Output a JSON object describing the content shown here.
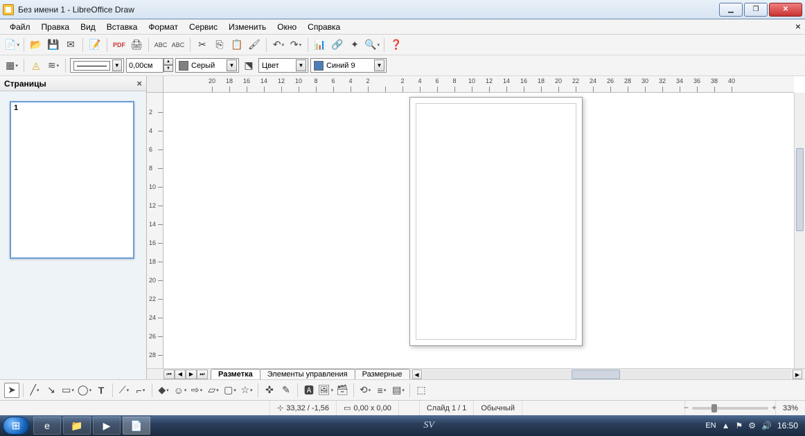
{
  "window": {
    "title": "Без имени 1 - LibreOffice Draw"
  },
  "menu": {
    "file": "Файл",
    "edit": "Правка",
    "view": "Вид",
    "insert": "Вставка",
    "format": "Формат",
    "tools": "Сервис",
    "modify": "Изменить",
    "window": "Окно",
    "help": "Справка"
  },
  "toolbar2": {
    "line_width": "0,00см",
    "area_color_label": "Серый",
    "area_color_hex": "#808080",
    "fill_mode": "Цвет",
    "line_color_label": "Синий 9",
    "line_color_hex": "#4a7ebb"
  },
  "sidebar": {
    "title": "Страницы",
    "page_number": "1"
  },
  "ruler_h": [
    "20",
    "18",
    "16",
    "14",
    "12",
    "10",
    "8",
    "6",
    "4",
    "2",
    "",
    "2",
    "4",
    "6",
    "8",
    "10",
    "12",
    "14",
    "16",
    "18",
    "20",
    "22",
    "24",
    "26",
    "28",
    "30",
    "32",
    "34",
    "36",
    "38",
    "40"
  ],
  "ruler_v": [
    "2",
    "4",
    "6",
    "8",
    "10",
    "12",
    "14",
    "16",
    "18",
    "20",
    "22",
    "24",
    "26",
    "28"
  ],
  "layer_tabs": {
    "t1": "Разметка",
    "t2": "Элементы управления",
    "t3": "Размерные"
  },
  "status": {
    "pos": "33,32 / -1,56",
    "size": "0,00 x 0,00",
    "slide": "Слайд 1 / 1",
    "style": "Обычный",
    "signature": "SV",
    "zoom": "33%"
  },
  "tray": {
    "lang": "EN",
    "time": "16:50"
  }
}
